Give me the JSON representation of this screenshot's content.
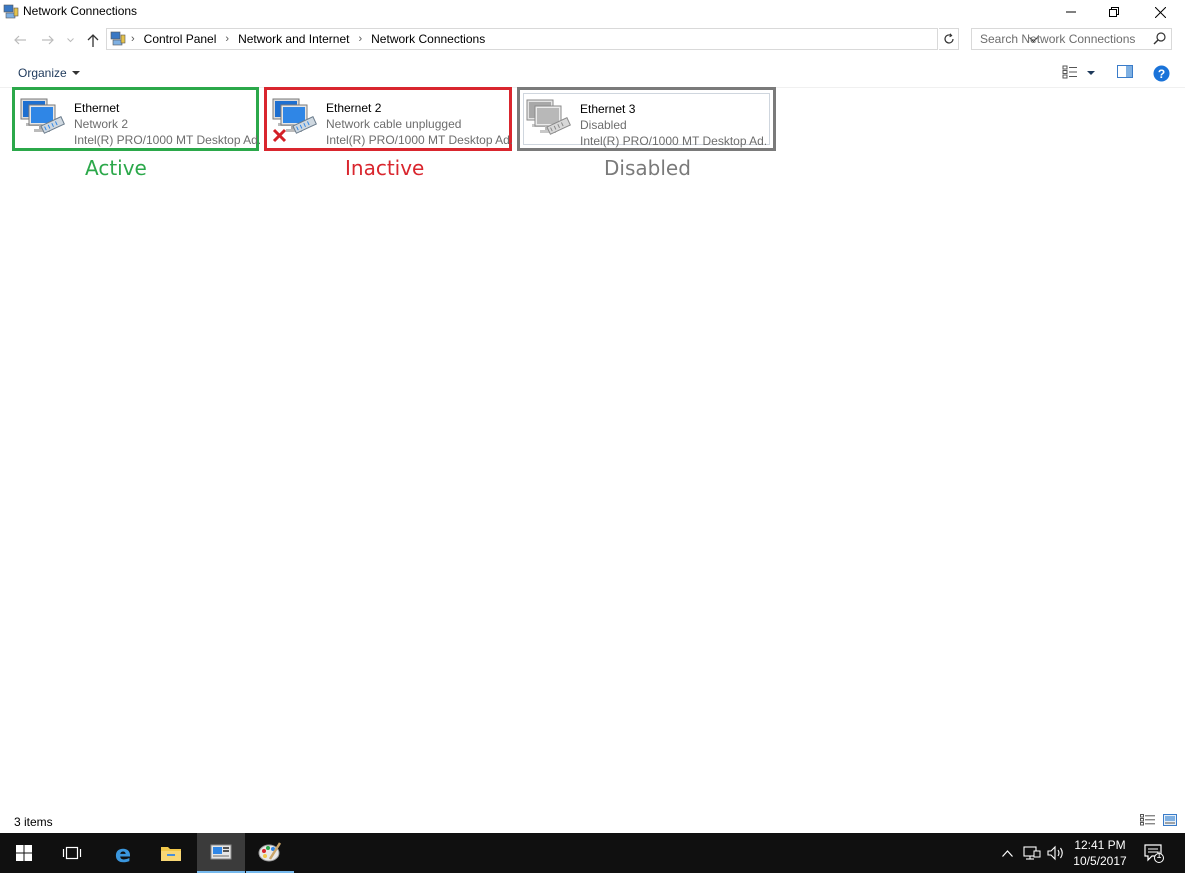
{
  "window": {
    "title": "Network Connections"
  },
  "address": {
    "crumbs": [
      "Control Panel",
      "Network and Internet",
      "Network Connections"
    ],
    "search_placeholder": "Search Network Connections"
  },
  "commandbar": {
    "organize_label": "Organize"
  },
  "connections": [
    {
      "name": "Ethernet",
      "status": "Network  2",
      "device": "Intel(R) PRO/1000 MT Desktop Ad...",
      "state_label": "Active",
      "frame_color": "#2ba84a",
      "icon": "network-connected-icon"
    },
    {
      "name": "Ethernet 2",
      "status": "Network cable unplugged",
      "device": "Intel(R) PRO/1000 MT Desktop Ad...",
      "state_label": "Inactive",
      "frame_color": "#d9262e",
      "icon": "network-unplugged-icon"
    },
    {
      "name": "Ethernet 3",
      "status": "Disabled",
      "device": "Intel(R) PRO/1000 MT Desktop Ad...",
      "state_label": "Disabled",
      "frame_color": "#7a7a7a",
      "icon": "network-disabled-icon"
    }
  ],
  "statusbar": {
    "item_count": "3 items"
  },
  "taskbar": {
    "time": "12:41 PM",
    "date": "10/5/2017",
    "notification_count": "1"
  },
  "colors": {
    "active": "#2ba84a",
    "inactive": "#d9262e",
    "disabled": "#7a7a7a",
    "help": "#1a73d9"
  }
}
